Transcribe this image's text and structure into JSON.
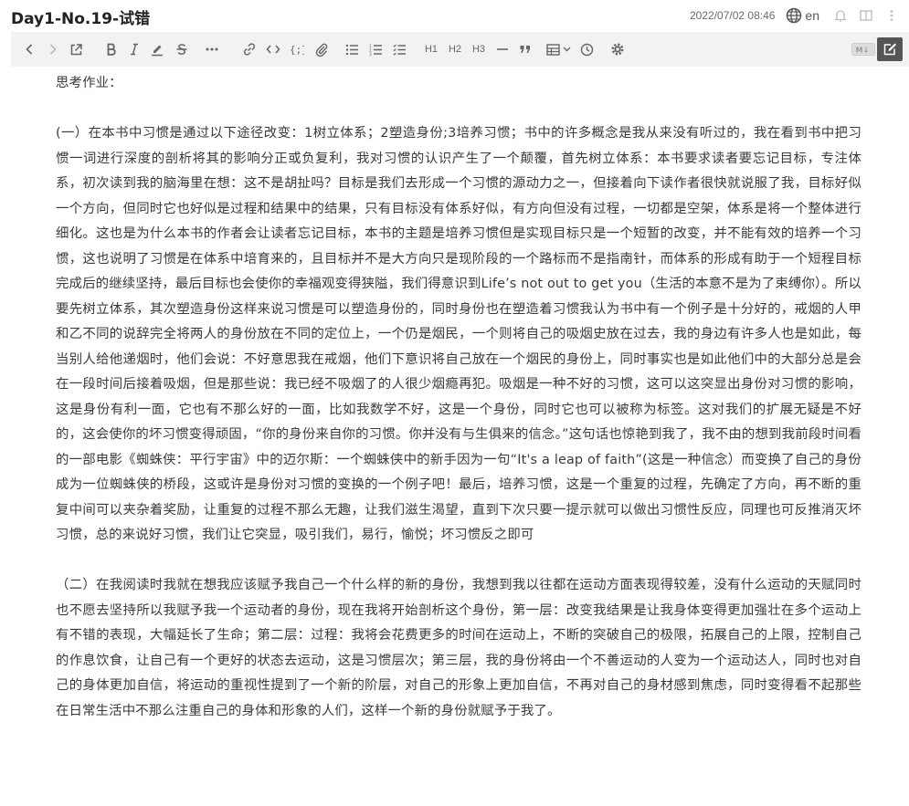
{
  "header": {
    "title": "Day1-No.19-试错",
    "date": "2022/07/02 08:46",
    "language": "en"
  },
  "toolbar": {
    "h1": "H1",
    "h2": "H2",
    "h3": "H3",
    "md_badge": "M↓"
  },
  "content": {
    "heading": "思考作业：",
    "paragraph1": "(一）在本书中习惯是通过以下途径改变：1树立体系；2塑造身份;3培养习惯；书中的许多概念是我从来没有听过的，我在看到书中把习惯一词进行深度的剖析将其的影响分正或负复利，我对习惯的认识产生了一个颠覆，首先树立体系：本书要求读者要忘记目标，专注体系，初次读到我的脑海里在想：这不是胡扯吗？目标是我们去形成一个习惯的源动力之一，但接着向下读作者很快就说服了我，目标好似一个方向，但同时它也好似是过程和结果中的结果，只有目标没有体系好似，有方向但没有过程，一切都是空架，体系是将一个整体进行细化。这也是为什么本书的作者会让读者忘记目标，本书的主题是培养习惯但是实现目标只是一个短暂的改变，并不能有效的培养一个习惯，这也说明了习惯是在体系中培育来的，且目标并不是大方向只是现阶段的一个路标而不是指南针，而体系的形成有助于一个短程目标完成后的继续坚持，最后目标也会使你的幸福观变得狭隘，我们得意识到Life’s not out to get you（生活的本意不是为了束缚你）。所以要先树立体系，其次塑造身份这样来说习惯是可以塑造身份的，同时身份也在塑造着习惯我认为书中有一个例子是十分好的，戒烟的人甲和乙不同的说辞完全将两人的身份放在不同的定位上，一个仍是烟民，一个则将自己的吸烟史放在过去，我的身边有许多人也是如此，每当别人给他递烟时，他们会说：不好意思我在戒烟，他们下意识将自己放在一个烟民的身份上，同时事实也是如此他们中的大部分总是会在一段时间后接着吸烟，但是那些说：我已经不吸烟了的人很少烟瘾再犯。吸烟是一种不好的习惯，这可以这突显出身份对习惯的影响，这是身份有利一面，它也有不那么好的一面，比如我数学不好，这是一个身份，同时它也可以被称为标签。这对我们的扩展无疑是不好的，这会使你的坏习惯变得顽固，“你的身份来自你的习惯。你并没有与生俱来的信念。”这句话也惊艳到我了，我不由的想到我前段时间看的一部电影《蜘蛛侠：平行宇宙》中的迈尔斯：一个蜘蛛侠中的新手因为一句“It's a leap of faith”(这是一种信念）而变换了自己的身份成为一位蜘蛛侠的桥段，这或许是身份对习惯的变换的一个例子吧！最后，培养习惯，这是一个重复的过程，先确定了方向，再不断的重复中间可以夹杂着奖励，让重复的过程不那么无趣，让我们滋生渴望，直到下次只要一提示就可以做出习惯性反应，同理也可反推消灭坏习惯，总的来说好习惯，我们让它突显，吸引我们，易行，愉悦；坏习惯反之即可",
    "paragraph2": "（二）在我阅读时我就在想我应该赋予我自己一个什么样的新的身份，我想到我以往都在运动方面表现得较差，没有什么运动的天赋同时也不愿去坚持所以我赋予我一个运动者的身份，现在我将开始剖析这个身份，第一层：改变我结果是让我身体变得更加强壮在多个运动上有不错的表现，大幅延长了生命；第二层：过程：我将会花费更多的时间在运动上，不断的突破自己的极限，拓展自己的上限，控制自己的作息饮食，让自己有一个更好的状态去运动，这是习惯层次；第三层，我的身份将由一个不善运动的人变为一个运动达人，同时也对自己的身体更加自信，将运动的重视性提到了一个新的阶层，对自己的形象上更加自信，不再对自己的身材感到焦虑，同时变得看不起那些在日常生活中不那么注重自己的身体和形象的人们，这样一个新的身份就赋予于我了。"
  }
}
